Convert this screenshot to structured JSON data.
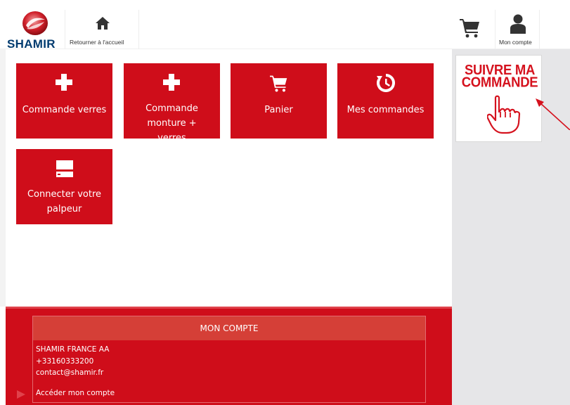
{
  "header": {
    "brand": "SHAMIR",
    "home_label": "Retourner à l'accueil",
    "account_label": "Mon compte"
  },
  "tiles": [
    {
      "label": "Commande verres",
      "icon": "plus-icon"
    },
    {
      "label": "Commande monture + verres",
      "icon": "plus-icon"
    },
    {
      "label": "Panier",
      "icon": "cart-icon"
    },
    {
      "label": "Mes commandes",
      "icon": "history-icon"
    },
    {
      "label": "Connecter votre palpeur",
      "icon": "tracer-device-icon"
    }
  ],
  "promo": {
    "line1": "SUIVRE MA",
    "line2": "COMMANDE",
    "icon": "pointing-hand-icon"
  },
  "account": {
    "title": "MON COMPTE",
    "company": "SHAMIR FRANCE AA",
    "phone": "+33160333200",
    "email": "contact@shamir.fr",
    "link": "Accéder mon compte"
  },
  "colors": {
    "brand_red": "#cf0d1a",
    "account_header": "#d53f37",
    "sidebar": "#e6e6e8",
    "logo_blue": "#003b6f"
  }
}
